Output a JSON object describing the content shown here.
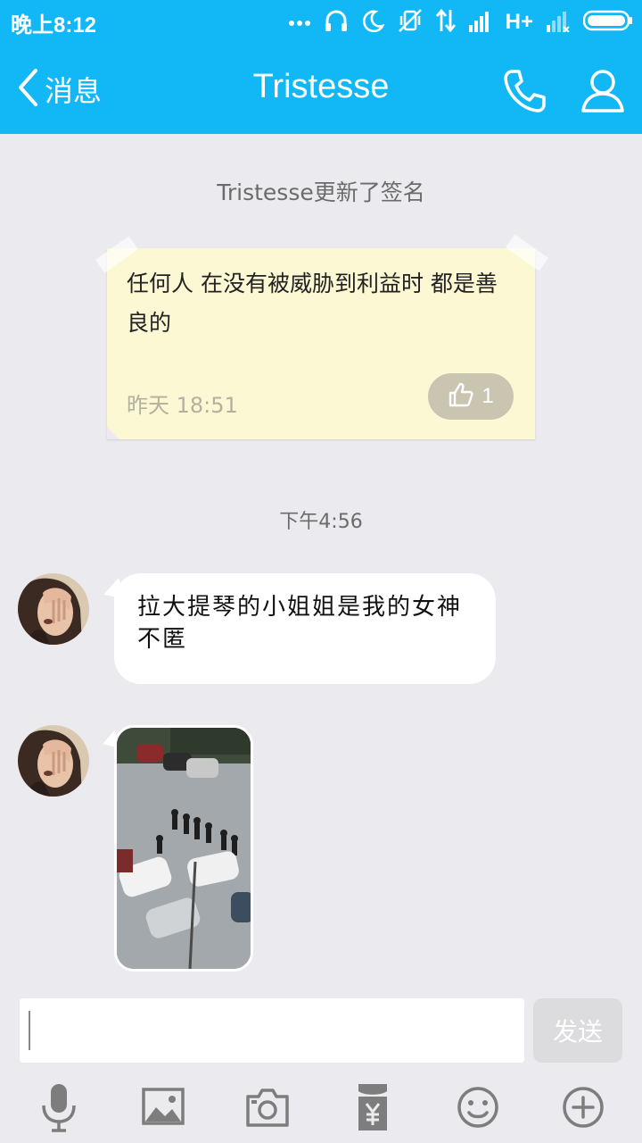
{
  "status_bar": {
    "time": "晚上8:12",
    "network": "H+",
    "icons": [
      "more-dots-icon",
      "headphones-icon",
      "moon-icon",
      "vibrate-off-icon",
      "data-arrows-icon",
      "signal-icon",
      "signal-weak-icon",
      "battery-icon"
    ]
  },
  "header": {
    "back_label": "消息",
    "title": "Tristesse",
    "icons": [
      "chevron-left-icon",
      "phone-icon",
      "person-icon"
    ]
  },
  "chat": {
    "signature_notice": "Tristesse更新了签名",
    "signature_card": {
      "text": "任何人 在没有被威胁到利益时 都是善良的",
      "time": "昨天 18:51",
      "likes": "1"
    },
    "timestamp": "下午4:56",
    "messages": [
      {
        "type": "text",
        "text": "拉大提琴的小姐姐是我的女神 不匿"
      },
      {
        "type": "image"
      }
    ]
  },
  "composer": {
    "input_value": "",
    "send_label": "发送"
  },
  "toolbar": {
    "icons": [
      "microphone-icon",
      "image-icon",
      "camera-icon",
      "red-packet-icon",
      "emoji-icon",
      "plus-icon"
    ]
  },
  "colors": {
    "header": "#12b7f5",
    "chat_background": "#ebebef",
    "note_background": "#fdf8d4",
    "icon_gray": "#7d7d7d"
  }
}
